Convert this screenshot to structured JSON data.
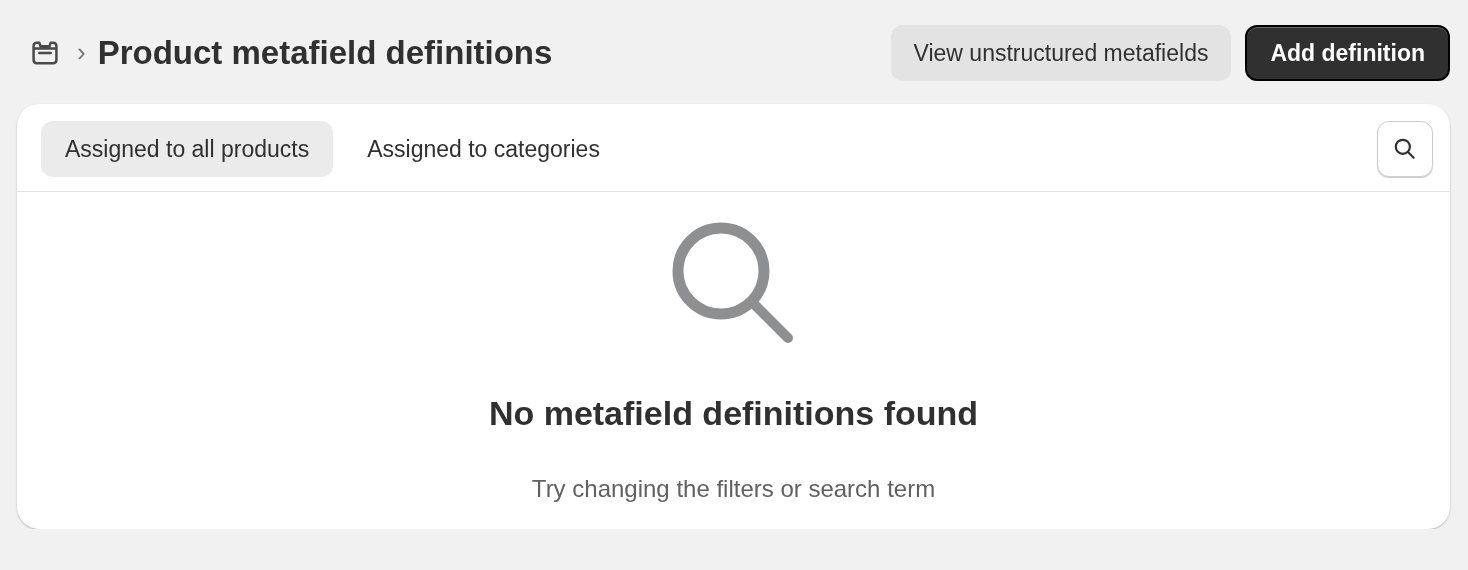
{
  "header": {
    "breadcrumb_separator": "›",
    "title": "Product metafield definitions",
    "buttons": [
      {
        "label": "View unstructured metafields",
        "kind": "secondary"
      },
      {
        "label": "Add definition",
        "kind": "primary"
      }
    ]
  },
  "tabs": [
    {
      "label": "Assigned to all products",
      "selected": true
    },
    {
      "label": "Assigned to categories",
      "selected": false
    }
  ],
  "empty_state": {
    "heading": "No metafield definitions found",
    "message": "Try changing the filters or search term"
  }
}
